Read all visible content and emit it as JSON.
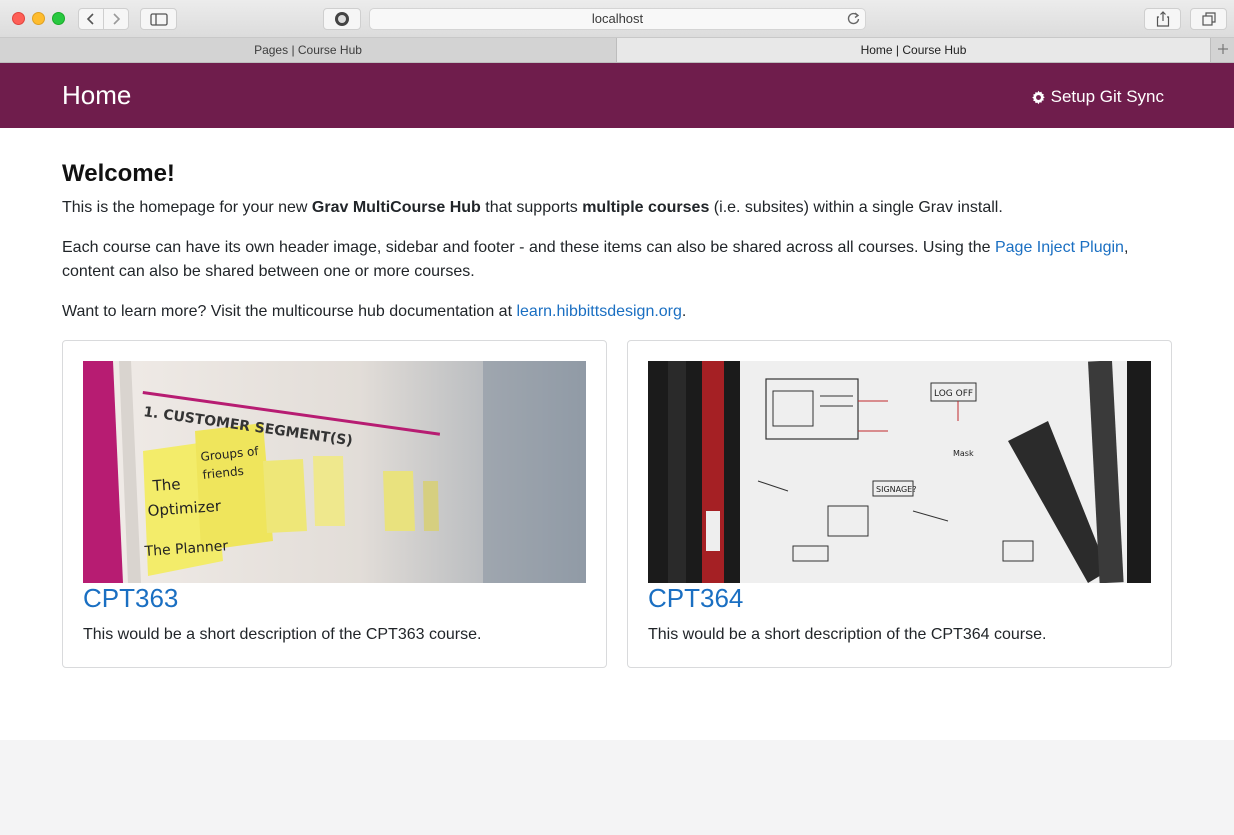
{
  "browser": {
    "url": "localhost",
    "tabs": [
      {
        "label": "Pages | Course Hub"
      },
      {
        "label": "Home | Course Hub"
      }
    ]
  },
  "header": {
    "title": "Home",
    "git_sync_label": "Setup Git Sync"
  },
  "main": {
    "heading": "Welcome!",
    "p1": {
      "pre": "This is the homepage for your new ",
      "bold1": "Grav MultiCourse Hub",
      "mid": " that supports ",
      "bold2": "multiple courses",
      "post": " (i.e. subsites) within a single Grav install."
    },
    "p2": {
      "pre": "Each course can have its own header image, sidebar and footer - and these items can also be shared across all courses. Using the ",
      "link": "Page Inject Plugin",
      "post": ", content can also be shared between one or more courses."
    },
    "p3": {
      "pre": "Want to learn more? Visit the multicourse hub documentation at ",
      "link": "learn.hibbittsdesign.org",
      "post": "."
    },
    "cards": [
      {
        "title": "CPT363",
        "description": "This would be a short description of the CPT363 course."
      },
      {
        "title": "CPT364",
        "description": "This would be a short description of the CPT364 course."
      }
    ]
  },
  "colors": {
    "header_bg": "#6f1d4c",
    "link": "#1a6fc2"
  }
}
